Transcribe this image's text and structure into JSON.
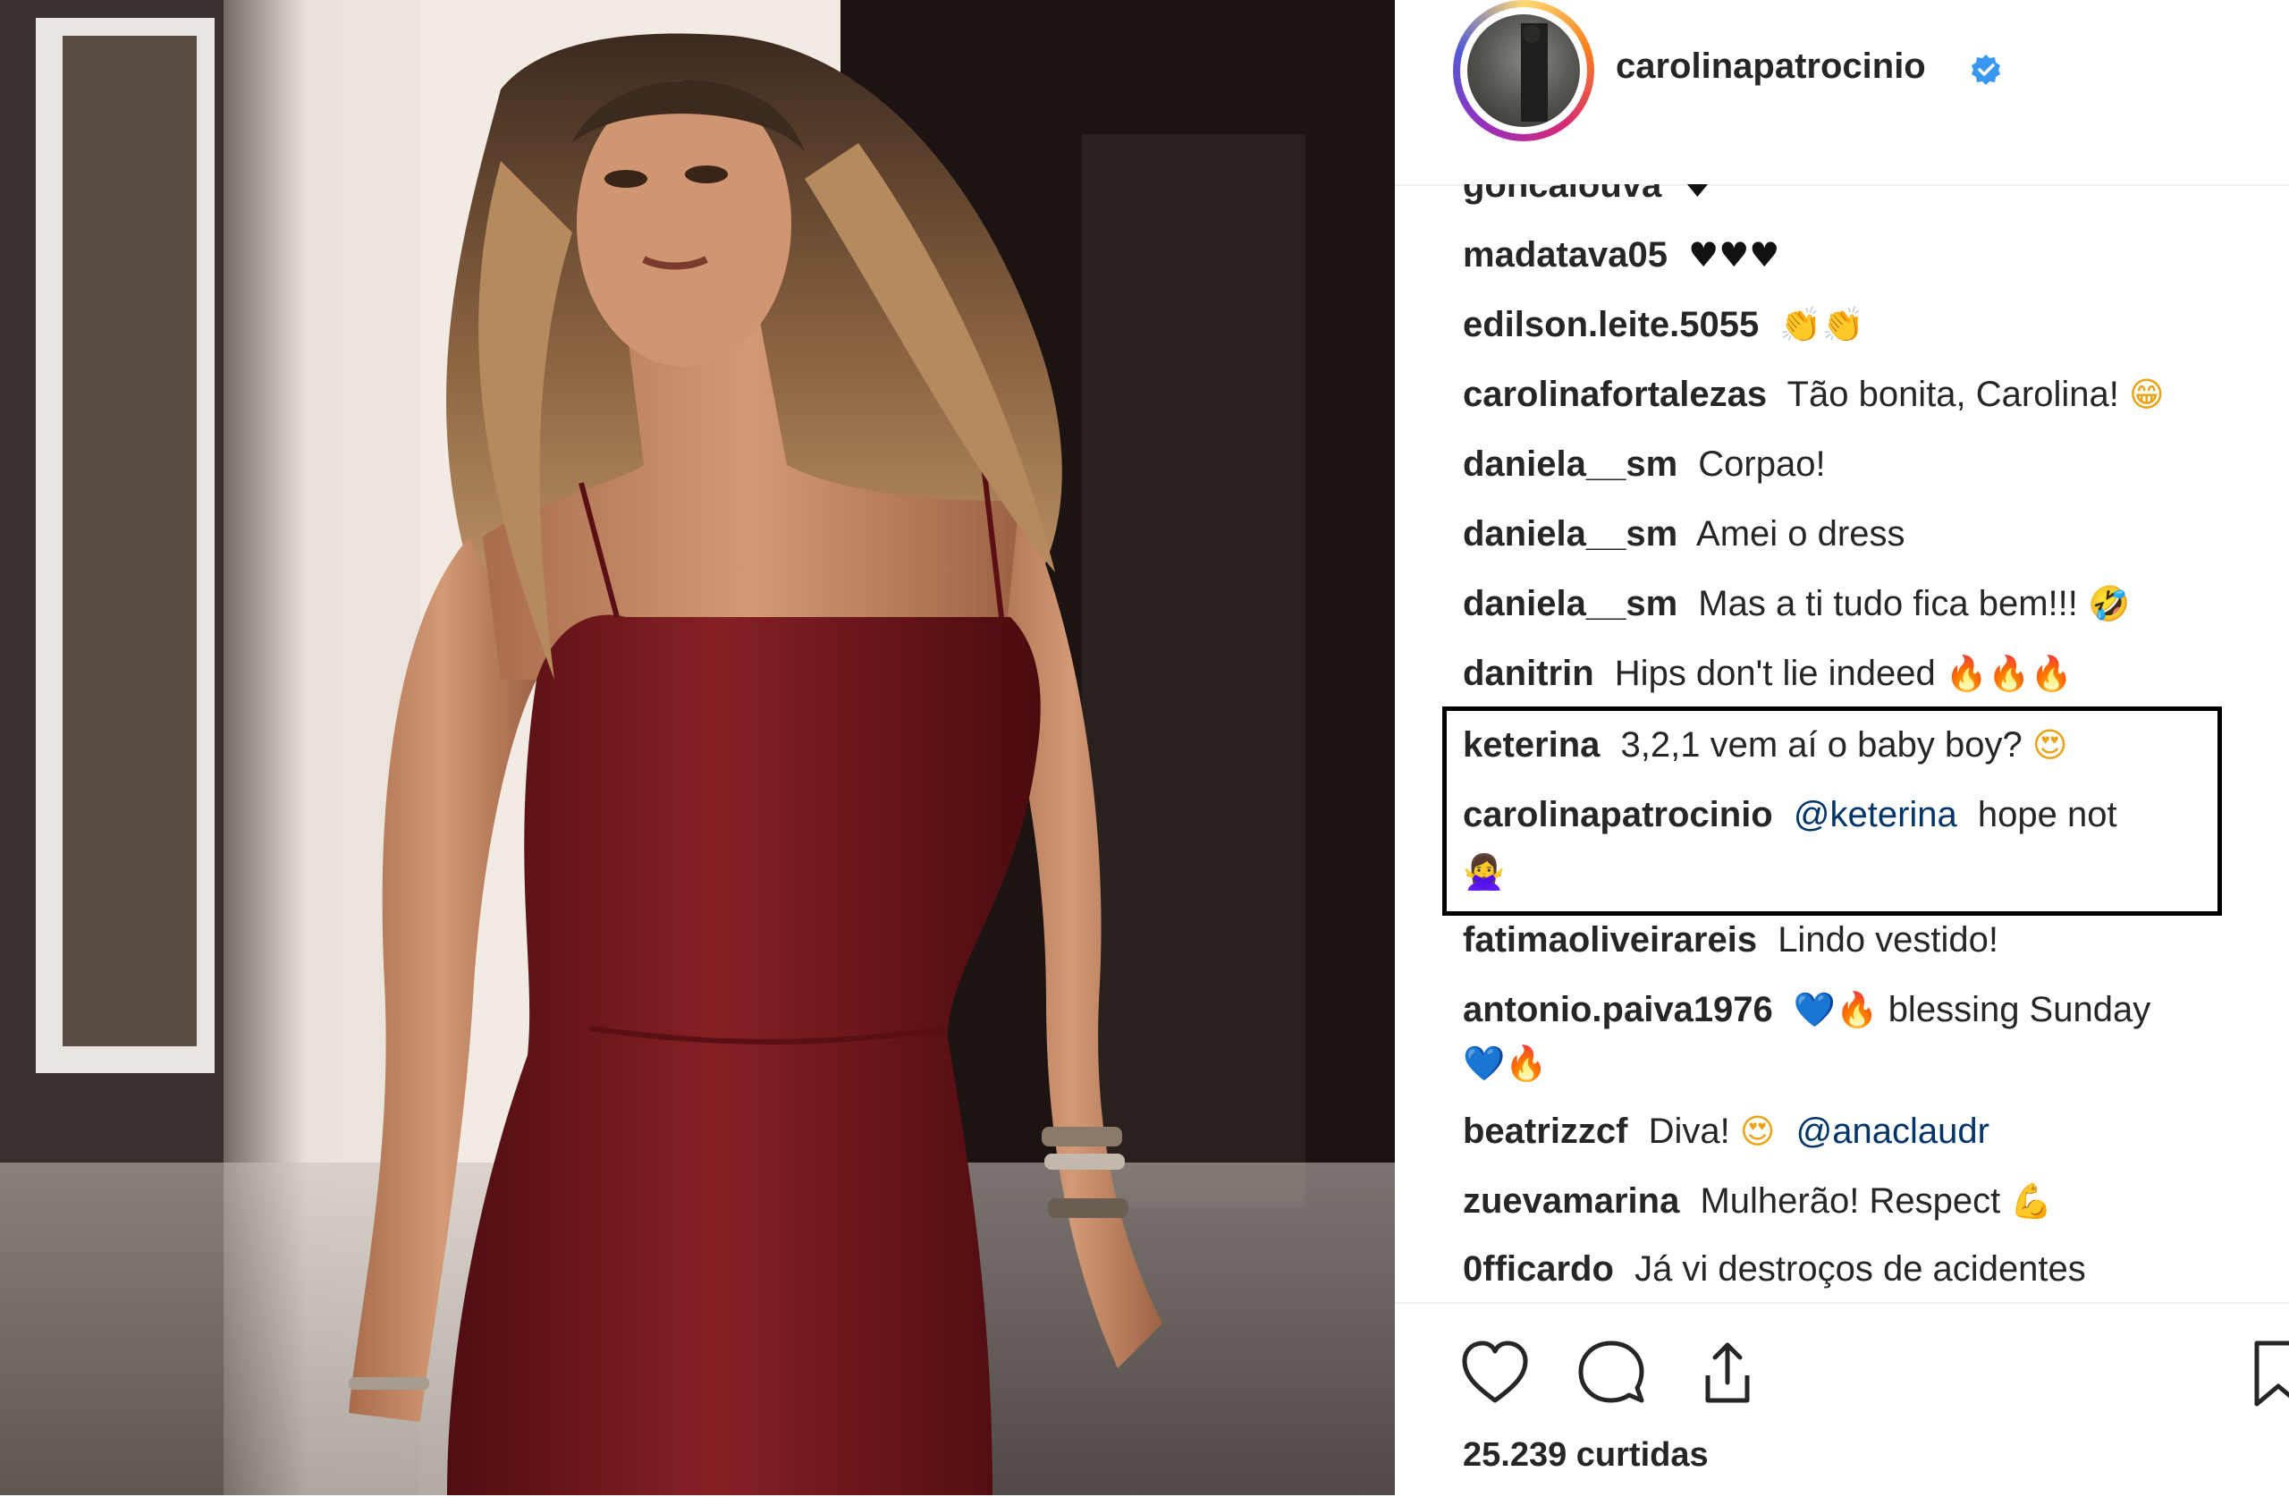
{
  "post": {
    "author": "carolinapatrocinio",
    "verified": true,
    "likes_text": "25.239 curtidas"
  },
  "comments": [
    {
      "user": "goncalouva",
      "text": "",
      "emoji": "♥",
      "emoji_class": "e-heart-black"
    },
    {
      "user": "madatava05",
      "text": "",
      "emoji": "♥♥♥",
      "emoji_class": "e-heart-black"
    },
    {
      "user": "edilson.leite.5055",
      "text": "",
      "emoji": "👏👏",
      "emoji_class": "e-clap"
    },
    {
      "user": "carolinafortalezas",
      "text": "Tão bonita, Carolina!",
      "emoji": "😁",
      "emoji_class": "e-face"
    },
    {
      "user": "daniela__sm",
      "text": "Corpao!",
      "emoji": "",
      "emoji_class": ""
    },
    {
      "user": "daniela__sm",
      "text": "Amei o dress",
      "emoji": "",
      "emoji_class": ""
    },
    {
      "user": "daniela__sm",
      "text": "Mas a ti tudo fica bem!!!",
      "emoji": "🤣",
      "emoji_class": "e-face"
    },
    {
      "user": "danitrin",
      "text": "Hips don't lie indeed",
      "emoji": "🔥🔥🔥",
      "emoji_class": "e-fire"
    },
    {
      "user": "keterina",
      "text": "3,2,1 vem aí o baby boy?",
      "emoji": "😍",
      "emoji_class": "e-face"
    },
    {
      "user": "carolinapatrocinio",
      "mention": "@keterina",
      "text": "hope not",
      "emoji_line2": "🙅‍♀",
      "emoji_class": "e-woman"
    },
    {
      "user": "fatimaoliveirareis",
      "text": "Lindo vestido!",
      "emoji": "",
      "emoji_class": ""
    },
    {
      "user": "antonio.paiva1976",
      "text": "blessing Sunday",
      "emoji_before": "💙🔥",
      "emoji_line2": "💙🔥"
    },
    {
      "user": "beatrizzcf",
      "text": "Diva!",
      "emoji": "😍",
      "emoji_class": "e-face",
      "mention_after": "@anaclaudr"
    },
    {
      "user": "zuevamarina",
      "text": "Mulherão! Respect",
      "emoji": "💪",
      "emoji_class": "e-flex"
    },
    {
      "user": "0fficardo",
      "text": "Já vi destroços de acidentes",
      "emoji": "",
      "emoji_class": ""
    }
  ],
  "colors": {
    "text": "#262626",
    "mention": "#003569",
    "verified_blue": "#3897f0",
    "dress_red": "#7b1a1e",
    "highlight_border": "#000000"
  },
  "icons": [
    "heart-icon",
    "comment-icon",
    "share-icon",
    "bookmark-icon",
    "verified-badge-icon"
  ]
}
